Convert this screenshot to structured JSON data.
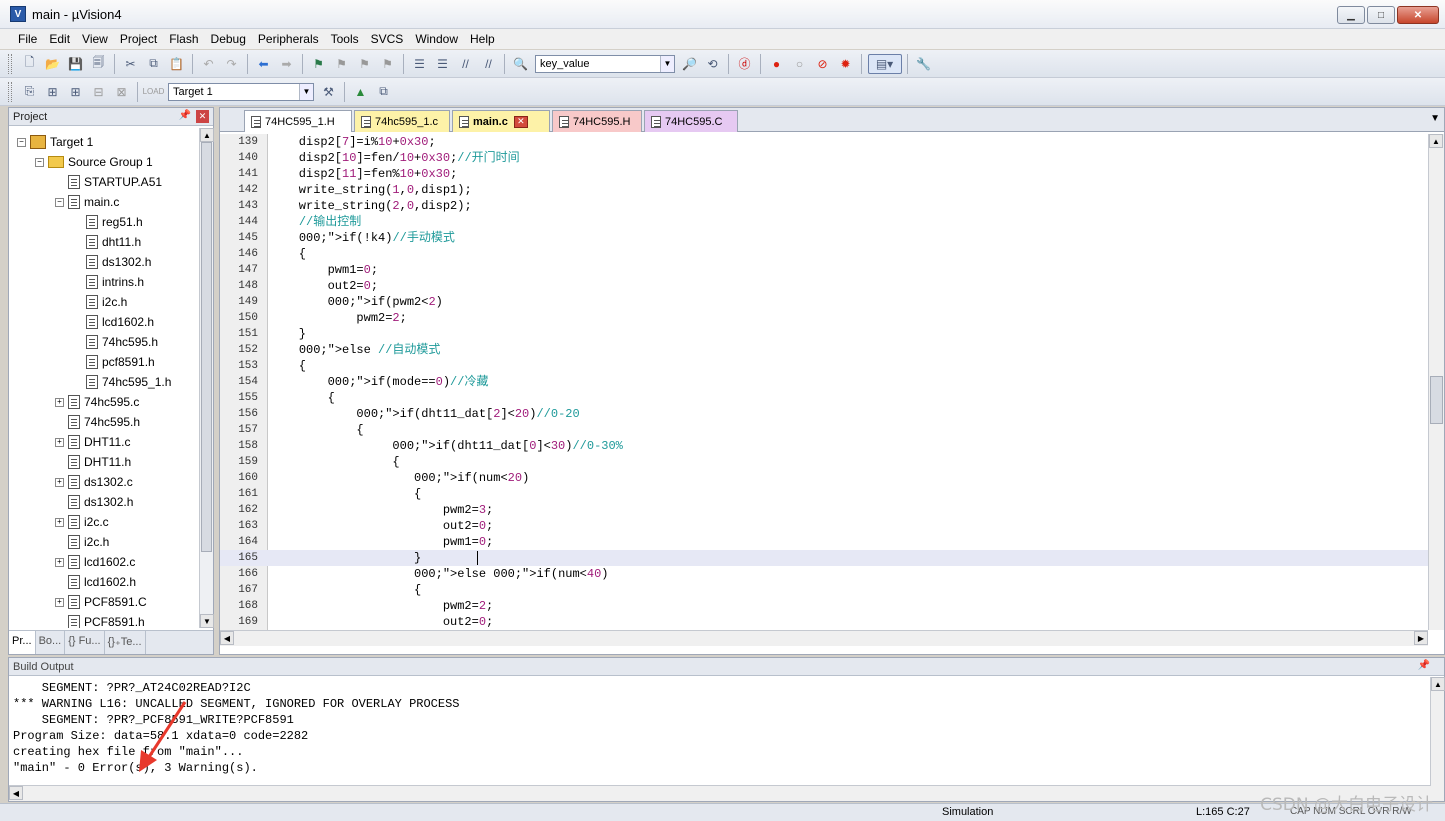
{
  "window": {
    "title": "main  - µVision4",
    "icon": "V"
  },
  "menu": [
    "File",
    "Edit",
    "View",
    "Project",
    "Flash",
    "Debug",
    "Peripherals",
    "Tools",
    "SVCS",
    "Window",
    "Help"
  ],
  "toolbar": {
    "find_combo": "key_value",
    "target_combo": "Target 1"
  },
  "project_panel": {
    "title": "Project",
    "tree": [
      {
        "label": "Target 1",
        "kind": "target",
        "level": 0,
        "exp": "−"
      },
      {
        "label": "Source Group 1",
        "kind": "folder",
        "level": 1,
        "exp": "−"
      },
      {
        "label": "STARTUP.A51",
        "kind": "file",
        "level": 2,
        "exp": ""
      },
      {
        "label": "main.c",
        "kind": "file",
        "level": 2,
        "exp": "−"
      },
      {
        "label": "reg51.h",
        "kind": "file",
        "level": 3,
        "exp": ""
      },
      {
        "label": "dht11.h",
        "kind": "file",
        "level": 3,
        "exp": ""
      },
      {
        "label": "ds1302.h",
        "kind": "file",
        "level": 3,
        "exp": ""
      },
      {
        "label": "intrins.h",
        "kind": "file",
        "level": 3,
        "exp": ""
      },
      {
        "label": "i2c.h",
        "kind": "file",
        "level": 3,
        "exp": ""
      },
      {
        "label": "lcd1602.h",
        "kind": "file",
        "level": 3,
        "exp": ""
      },
      {
        "label": "74hc595.h",
        "kind": "file",
        "level": 3,
        "exp": ""
      },
      {
        "label": "pcf8591.h",
        "kind": "file",
        "level": 3,
        "exp": ""
      },
      {
        "label": "74hc595_1.h",
        "kind": "file",
        "level": 3,
        "exp": ""
      },
      {
        "label": "74hc595.c",
        "kind": "file",
        "level": 2,
        "exp": "+"
      },
      {
        "label": "74hc595.h",
        "kind": "file",
        "level": 2,
        "exp": ""
      },
      {
        "label": "DHT11.c",
        "kind": "file",
        "level": 2,
        "exp": "+"
      },
      {
        "label": "DHT11.h",
        "kind": "file",
        "level": 2,
        "exp": ""
      },
      {
        "label": "ds1302.c",
        "kind": "file",
        "level": 2,
        "exp": "+"
      },
      {
        "label": "ds1302.h",
        "kind": "file",
        "level": 2,
        "exp": ""
      },
      {
        "label": "i2c.c",
        "kind": "file",
        "level": 2,
        "exp": "+"
      },
      {
        "label": "i2c.h",
        "kind": "file",
        "level": 2,
        "exp": ""
      },
      {
        "label": "lcd1602.c",
        "kind": "file",
        "level": 2,
        "exp": "+"
      },
      {
        "label": "lcd1602.h",
        "kind": "file",
        "level": 2,
        "exp": ""
      },
      {
        "label": "PCF8591.C",
        "kind": "file",
        "level": 2,
        "exp": "+"
      },
      {
        "label": "PCF8591.h",
        "kind": "file",
        "level": 2,
        "exp": ""
      }
    ],
    "tabs": [
      "Pr...",
      "Bo...",
      "{} Fu...",
      "{}₊Te..."
    ]
  },
  "editor": {
    "tabs": [
      {
        "label": "74HC595_1.H",
        "bg": "#ffffff",
        "bold": false
      },
      {
        "label": "74hc595_1.c",
        "bg": "#fdf2a8",
        "bold": false
      },
      {
        "label": "main.c",
        "bg": "#fdf2a8",
        "bold": true
      },
      {
        "label": "74HC595.H",
        "bg": "#f8c9c9",
        "bold": false
      },
      {
        "label": "74HC595.C",
        "bg": "#e6c9f2",
        "bold": false
      }
    ],
    "current_line": 165,
    "lines": [
      {
        "n": "139",
        "t": "    disp2[7]=i%10+0x30;"
      },
      {
        "n": "140",
        "t": "    disp2[10]=fen/10+0x30;//开门时间"
      },
      {
        "n": "141",
        "t": "    disp2[11]=fen%10+0x30;"
      },
      {
        "n": "142",
        "t": "    write_string(1,0,disp1);"
      },
      {
        "n": "143",
        "t": "    write_string(2,0,disp2);"
      },
      {
        "n": "144",
        "t": "    //输出控制"
      },
      {
        "n": "145",
        "t": "    if(!k4)//手动模式"
      },
      {
        "n": "146",
        "t": "    {"
      },
      {
        "n": "147",
        "t": "        pwm1=0;"
      },
      {
        "n": "148",
        "t": "        out2=0;"
      },
      {
        "n": "149",
        "t": "        if(pwm2<2)"
      },
      {
        "n": "150",
        "t": "            pwm2=2;"
      },
      {
        "n": "151",
        "t": "    }"
      },
      {
        "n": "152",
        "t": "    else //自动模式"
      },
      {
        "n": "153",
        "t": "    {"
      },
      {
        "n": "154",
        "t": "        if(mode==0)//冷藏"
      },
      {
        "n": "155",
        "t": "        {"
      },
      {
        "n": "156",
        "t": "            if(dht11_dat[2]<20)//0-20"
      },
      {
        "n": "157",
        "t": "            {"
      },
      {
        "n": "158",
        "t": "                 if(dht11_dat[0]<30)//0-30%"
      },
      {
        "n": "159",
        "t": "                 {"
      },
      {
        "n": "160",
        "t": "                    if(num<20)"
      },
      {
        "n": "161",
        "t": "                    {"
      },
      {
        "n": "162",
        "t": "                        pwm2=3;"
      },
      {
        "n": "163",
        "t": "                        out2=0;"
      },
      {
        "n": "164",
        "t": "                        pwm1=0;"
      },
      {
        "n": "165",
        "t": "                    }"
      },
      {
        "n": "166",
        "t": "                    else if(num<40)"
      },
      {
        "n": "167",
        "t": "                    {"
      },
      {
        "n": "168",
        "t": "                        pwm2=2;"
      },
      {
        "n": "169",
        "t": "                        out2=0;"
      }
    ]
  },
  "build_output": {
    "title": "Build Output",
    "lines": [
      "    SEGMENT: ?PR?_AT24C02READ?I2C",
      "*** WARNING L16: UNCALLED SEGMENT, IGNORED FOR OVERLAY PROCESS",
      "    SEGMENT: ?PR?_PCF8591_WRITE?PCF8591",
      "Program Size: data=58.1 xdata=0 code=2282",
      "creating hex file from \"main\"...",
      "\"main\" - 0 Error(s), 3 Warning(s)."
    ]
  },
  "statusbar": {
    "mode": "Simulation",
    "position": "L:165 C:27",
    "indicators": "CAP  NUM  SCRL  OVR  R/W"
  },
  "watermark": "CSDN @大白电子设计",
  "colors": {
    "annotation_arrow": "#e8392c",
    "current_line_bg": "#e6e8f5"
  }
}
